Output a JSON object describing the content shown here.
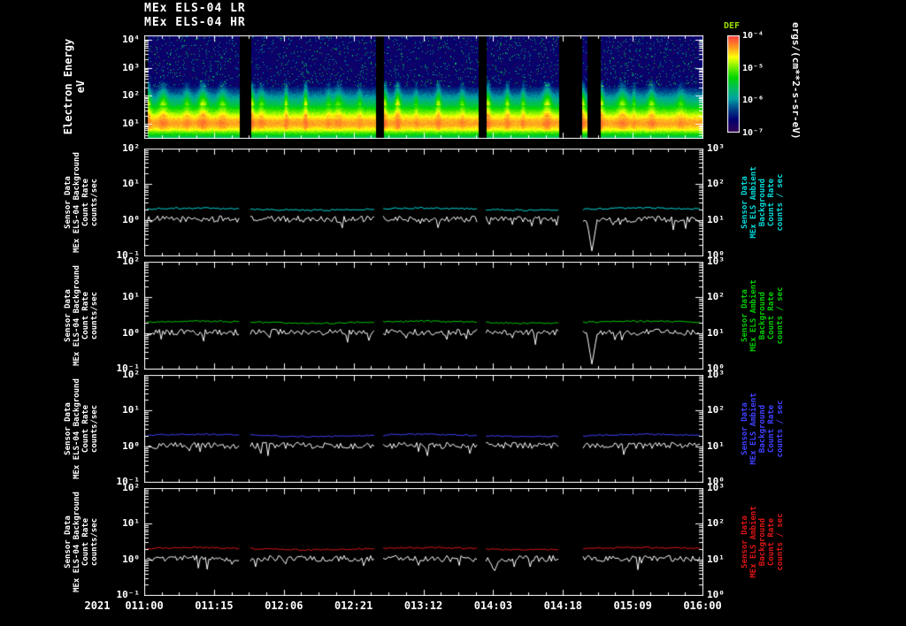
{
  "titles": {
    "line1": "MEx ELS-04 LR",
    "line2": "MEx ELS-04 HR"
  },
  "x_axis": {
    "year_label": "2021",
    "tick_labels": [
      "011:00",
      "011:15",
      "012:06",
      "012:21",
      "013:12",
      "014:03",
      "014:18",
      "015:09",
      "016:00"
    ]
  },
  "spectrogram": {
    "ylabel": "Electron Energy\neV",
    "y_tick_labels": [
      "10⁴",
      "10³",
      "10²",
      "10¹"
    ],
    "colorbar": {
      "title": "DEF",
      "title_color": "#9be000",
      "tick_labels": [
        "10⁻⁴",
        "10⁻⁵",
        "10⁻⁶",
        "10⁻⁷"
      ],
      "units_label": "ergs/(cm**2-s-sr-eV)"
    }
  },
  "line_panels": [
    {
      "color": "#00d9d9",
      "left_label": "Sensor Data\nMEx ELS-04 Background\nCount Rate\ncounts/sec",
      "right_label": "Sensor Data\nMEx ELS Ambient Background\nCount Rate\ncounts / sec",
      "left_tick_labels": [
        "10²",
        "10¹",
        "10⁰",
        "10⁻¹"
      ],
      "right_tick_labels": [
        "10³",
        "10²",
        "10¹",
        "10⁰"
      ]
    },
    {
      "color": "#00cc00",
      "left_label": "Sensor Data\nMEx ELS-04 Background\nCount Rate\ncounts/sec",
      "right_label": "Sensor Data\nMEx ELS Ambient Background\nCount Rate\ncounts / sec",
      "left_tick_labels": [
        "10²",
        "10¹",
        "10⁰",
        "10⁻¹"
      ],
      "right_tick_labels": [
        "10³",
        "10²",
        "10¹",
        "10⁰"
      ]
    },
    {
      "color": "#4040ff",
      "left_label": "Sensor Data\nMEx ELS-04 Background\nCount Rate\ncounts/sec",
      "right_label": "Sensor Data\nMEx ELS Ambient Background\nCount Rate\ncounts / sec",
      "left_tick_labels": [
        "10²",
        "10¹",
        "10⁰",
        "10⁻¹"
      ],
      "right_tick_labels": [
        "10³",
        "10²",
        "10¹",
        "10⁰"
      ]
    },
    {
      "color": "#dd1515",
      "left_label": "Sensor Data\nMEx ELS-04 Background\nCount Rate\ncounts/sec",
      "right_label": "Sensor Data\nMEx ELS Ambient Background\nCount Rate\ncounts / sec",
      "left_tick_labels": [
        "10²",
        "10¹",
        "10⁰",
        "10⁻¹"
      ],
      "right_tick_labels": [
        "10³",
        "10²",
        "10¹",
        "10⁰"
      ]
    }
  ],
  "colors": {
    "background": "#000000",
    "frame": "#ffffff",
    "palette_high_to_low": [
      "#ff0000",
      "#ff9900",
      "#ffff00",
      "#00cc00",
      "#00cccc",
      "#0000ff",
      "#7700bb"
    ]
  },
  "chart_data": [
    {
      "type": "heatmap",
      "title": "MEx ELS-04 LR / MEx ELS-04 HR electron energy-time spectrogram",
      "xlabel": "time (2021, ticks 011:00 to 016:00)",
      "ylabel": "Electron Energy (eV)",
      "y_scale": "log",
      "y_range": [
        1,
        10000
      ],
      "value_label": "DEF",
      "value_units": "ergs/(cm**2-s-sr-eV)",
      "value_range": [
        1e-07,
        0.0001
      ],
      "colorbar_tick_values": [
        0.0001,
        1e-05,
        1e-06,
        1e-07
      ],
      "palette": "rainbow, violet = low flux, red = high flux",
      "data_segments_fraction": [
        [
          0.005,
          0.17
        ],
        [
          0.19,
          0.413
        ],
        [
          0.428,
          0.597
        ],
        [
          0.612,
          0.742
        ],
        [
          0.782,
          0.792
        ],
        [
          0.815,
          0.998
        ]
      ],
      "features": [
        "dark violet/blue speckled low flux above ~300 eV",
        "blue-cyan diffuse flux 30-300 eV",
        "bright yellow-green band near 5-30 eV",
        "quasi-periodic vertical green/yellow flares reaching ~100 eV",
        "black vertical stripes are data gaps"
      ]
    },
    {
      "type": "line",
      "panel_index": 1,
      "y_scale": "log",
      "left_axis_range": [
        0.1,
        100
      ],
      "right_axis_range": [
        1,
        1000
      ],
      "units": "counts/sec",
      "segments_fraction": [
        [
          0.005,
          0.17
        ],
        [
          0.19,
          0.413
        ],
        [
          0.428,
          0.597
        ],
        [
          0.612,
          0.742
        ],
        [
          0.786,
          0.998
        ]
      ],
      "series": [
        {
          "name": "MEx ELS Ambient Background Count Rate",
          "color": "#00d9d9",
          "approx_level": 2.0
        },
        {
          "name": "MEx ELS-04 Background Count Rate",
          "color": "#ffffff",
          "approx_level": 1.05,
          "dip": {
            "x_fraction": 0.802,
            "min_value": 0.13
          }
        }
      ]
    },
    {
      "type": "line",
      "panel_index": 2,
      "y_scale": "log",
      "left_axis_range": [
        0.1,
        100
      ],
      "right_axis_range": [
        1,
        1000
      ],
      "units": "counts/sec",
      "segments_fraction": [
        [
          0.005,
          0.17
        ],
        [
          0.19,
          0.413
        ],
        [
          0.428,
          0.597
        ],
        [
          0.612,
          0.742
        ],
        [
          0.786,
          0.998
        ]
      ],
      "series": [
        {
          "name": "MEx ELS Ambient Background Count Rate",
          "color": "#00cc00",
          "approx_level": 2.0
        },
        {
          "name": "MEx ELS-04 Background Count Rate",
          "color": "#ffffff",
          "approx_level": 1.05,
          "dip": {
            "x_fraction": 0.802,
            "min_value": 0.13
          }
        }
      ]
    },
    {
      "type": "line",
      "panel_index": 3,
      "y_scale": "log",
      "left_axis_range": [
        0.1,
        100
      ],
      "right_axis_range": [
        1,
        1000
      ],
      "units": "counts/sec",
      "segments_fraction": [
        [
          0.005,
          0.17
        ],
        [
          0.19,
          0.413
        ],
        [
          0.428,
          0.597
        ],
        [
          0.612,
          0.742
        ],
        [
          0.786,
          0.998
        ]
      ],
      "series": [
        {
          "name": "MEx ELS Ambient Background Count Rate",
          "color": "#4040ff",
          "approx_level": 2.0
        },
        {
          "name": "MEx ELS-04 Background Count Rate",
          "color": "#ffffff",
          "approx_level": 1.05
        }
      ]
    },
    {
      "type": "line",
      "panel_index": 4,
      "y_scale": "log",
      "left_axis_range": [
        0.1,
        100
      ],
      "right_axis_range": [
        1,
        1000
      ],
      "units": "counts/sec",
      "segments_fraction": [
        [
          0.005,
          0.17
        ],
        [
          0.19,
          0.413
        ],
        [
          0.428,
          0.597
        ],
        [
          0.612,
          0.742
        ],
        [
          0.786,
          0.998
        ]
      ],
      "series": [
        {
          "name": "MEx ELS Ambient Background Count Rate",
          "color": "#dd1515",
          "approx_level": 2.0
        },
        {
          "name": "MEx ELS-04 Background Count Rate",
          "color": "#ffffff",
          "approx_level": 1.05,
          "dip": {
            "x_fraction": 0.627,
            "min_value": 0.45
          }
        }
      ]
    }
  ]
}
